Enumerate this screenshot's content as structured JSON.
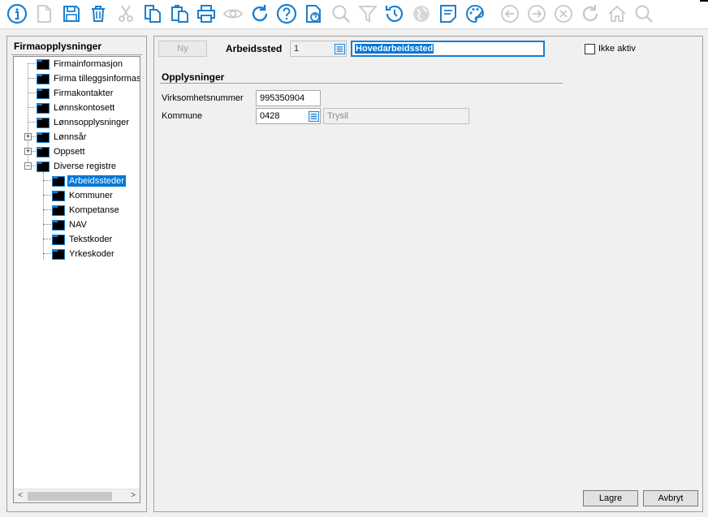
{
  "toolbar": {
    "icons": [
      "info-icon",
      "new-document-icon",
      "save-icon",
      "delete-icon",
      "cut-icon",
      "copy-icon",
      "paste-icon",
      "print-icon",
      "preview-icon",
      "refresh-icon",
      "help-icon",
      "help-document-icon",
      "search-icon",
      "filter-icon",
      "history-icon",
      "globe-icon",
      "note-icon",
      "palette-icon",
      "back-icon",
      "forward-icon",
      "cancel-icon",
      "redo-icon",
      "home-icon",
      "zoom-icon"
    ]
  },
  "left_panel": {
    "title": "Firmaopplysninger",
    "tree": [
      {
        "label": "Firmainformasjon",
        "level": 0
      },
      {
        "label": "Firma tilleggsinformasjon",
        "level": 0
      },
      {
        "label": "Firmakontakter",
        "level": 0
      },
      {
        "label": "Lønnskontosett",
        "level": 0
      },
      {
        "label": "Lønnsopplysninger",
        "level": 0
      },
      {
        "label": "Lønnsår",
        "level": 0,
        "expander": "+"
      },
      {
        "label": "Oppsett",
        "level": 0,
        "expander": "+"
      },
      {
        "label": "Diverse registre",
        "level": 0,
        "expander": "−"
      },
      {
        "label": "Arbeidssteder",
        "level": 1,
        "selected": true
      },
      {
        "label": "Kommuner",
        "level": 1
      },
      {
        "label": "Kompetanse",
        "level": 1
      },
      {
        "label": "NAV",
        "level": 1
      },
      {
        "label": "Tekstkoder",
        "level": 1
      },
      {
        "label": "Yrkeskoder",
        "level": 1
      }
    ],
    "scroll_left": "<",
    "scroll_right": ">"
  },
  "form": {
    "new_button": "Ny",
    "arbeidssted_label": "Arbeidssted",
    "arbeidssted_id": "1",
    "arbeidssted_name": "Hovedarbeidssted",
    "inactive_label": "Ikke aktiv",
    "inactive_checked": false,
    "section_title": "Opplysninger",
    "org_number_label": "Virksomhetsnummer",
    "org_number_value": "995350904",
    "municipality_label": "Kommune",
    "municipality_code": "0428",
    "municipality_name": "Trysil",
    "save_button": "Lagre",
    "cancel_button": "Avbryt"
  },
  "colors": {
    "accent_blue": "#1a7fcf",
    "selection": "#0078d7",
    "disabled_gray": "#c8c8c8"
  }
}
